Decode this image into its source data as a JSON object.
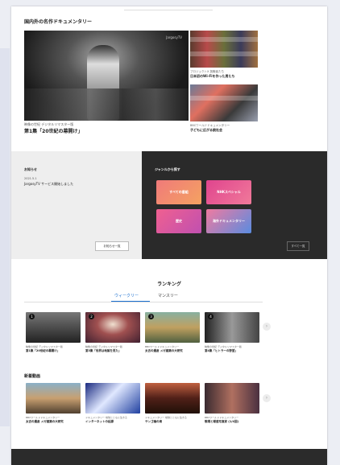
{
  "featured": {
    "section_title": "国内外の名作ドキュメンタリー",
    "watermark": "JargosyTV",
    "main": {
      "meta": "映像の世紀 デジタルリマスター版",
      "title": "第1集「20世紀の幕開け」"
    },
    "side": [
      {
        "meta": "プロジェクトX 挑戦者たち",
        "title": "日本初のWi-Fiを作った男たち"
      },
      {
        "meta": "BBCワールドドキュメンタリー",
        "title": "子どもに広がる銃社会"
      }
    ]
  },
  "news": {
    "label": "お知らせ",
    "date": "2021.5.1",
    "text": "JargosyTV サービス開始しました",
    "more_label": "お知らせ一覧"
  },
  "genre": {
    "label": "ジャンルから探す",
    "tiles": [
      "すべての番組",
      "NHKスペシャル",
      "歴史",
      "海外ドキュメンタリー"
    ],
    "more_label": "すべて一覧",
    "colors": [
      "#f07a7a",
      "#e0448e",
      "#e06a8a",
      "#5a8ce0"
    ]
  },
  "ranking": {
    "title": "ランキング",
    "tabs": [
      "ウィークリー",
      "マンスリー"
    ],
    "items": [
      {
        "rank": "1",
        "meta": "映像の世紀 デジタルリマスター版",
        "title": "第1集「20世紀の幕開け」"
      },
      {
        "rank": "2",
        "meta": "映像の世紀 デジタルリマスター版",
        "title": "第3集「世界は地獄を見た」"
      },
      {
        "rank": "3",
        "meta": "BBCワールドドキュメンタリー",
        "title": "太古の遺産 メガ建築の大研究"
      },
      {
        "rank": "4",
        "meta": "映像の世紀 デジタルリマスター版",
        "title": "第4集「ヒトラーの野望」"
      }
    ]
  },
  "new_videos": {
    "title": "新着動画",
    "items": [
      {
        "meta": "BBCワールドドキュメンタリー",
        "title": "太古の遺産 メガ建築の大研究"
      },
      {
        "meta": "ドキュメンタリー 地球とともに生きる",
        "title": "インターネットの起源"
      },
      {
        "meta": "ドキュメンタリー 地球とともに生きる",
        "title": "サンゴ礁の海"
      },
      {
        "meta": "BBCワールドドキュメンタリー",
        "title": "戦場と報道写真家 (1/4回)"
      }
    ]
  }
}
